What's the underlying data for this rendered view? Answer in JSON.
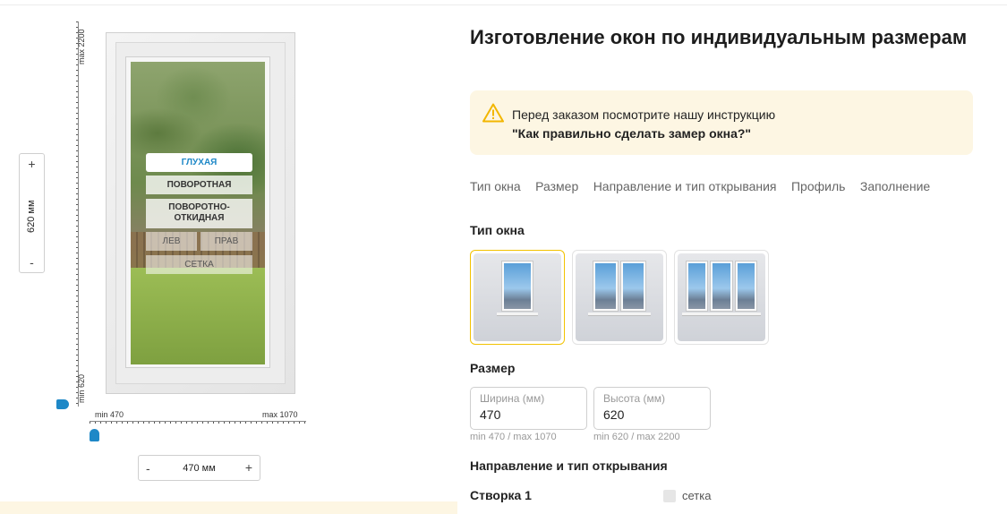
{
  "configurator": {
    "height_max": "max 2200",
    "height_min": "min 620",
    "width_min": "min 470",
    "width_max": "max 1070",
    "height_value": "620 мм",
    "width_value": "470 мм",
    "plus": "+",
    "minus": "-",
    "options": {
      "glukhaya": "ГЛУХАЯ",
      "povorotnaya": "ПОВОРОТНАЯ",
      "povorotno_otkidnaya": "ПОВОРОТНО-ОТКИДНАЯ",
      "left": "ЛЕВ",
      "right": "ПРАВ",
      "setka": "СЕТКА"
    },
    "accent_color": "#1e88c7"
  },
  "header": {
    "title": "Изготовление окон по индивидуальным размерам"
  },
  "notice": {
    "line1": "Перед заказом посмотрите нашу инструкцию",
    "line2": "\"Как правильно сделать замер окна?\"",
    "icon": "warning-icon",
    "icon_color": "#f2b600"
  },
  "tabs": [
    "Тип окна",
    "Размер",
    "Направление и тип открывания",
    "Профиль",
    "Заполнение"
  ],
  "window_type": {
    "heading": "Тип окна",
    "options": [
      {
        "icon": "single-sash-window-icon",
        "selected": true
      },
      {
        "icon": "double-sash-window-icon",
        "selected": false
      },
      {
        "icon": "triple-sash-window-icon",
        "selected": false
      }
    ],
    "selected_border_color": "#f2c200"
  },
  "size": {
    "heading": "Размер",
    "width_placeholder": "Ширина (мм)",
    "width_value": "470",
    "width_hint": "min 470 / max 1070",
    "height_placeholder": "Высота (мм)",
    "height_value": "620",
    "height_hint": "min 620 / max 2200"
  },
  "direction": {
    "heading": "Направление и тип открывания",
    "sash_label": "Створка 1",
    "setka_label": "сетка"
  }
}
